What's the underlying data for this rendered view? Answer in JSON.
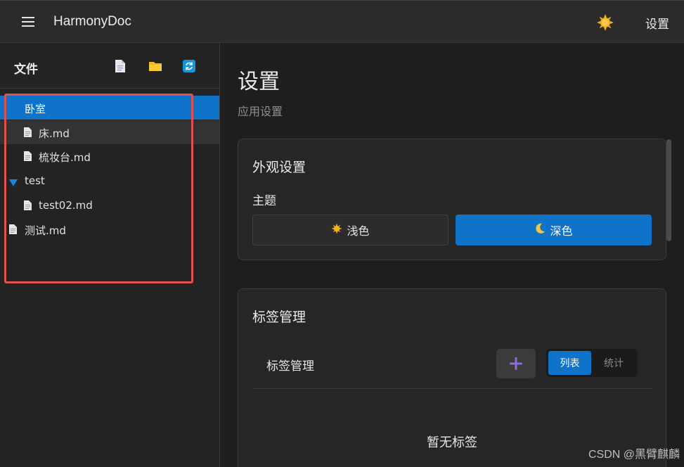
{
  "app": {
    "title": "HarmonyDoc",
    "settings_label": "设置"
  },
  "sidebar": {
    "title": "文件",
    "items": [
      {
        "label": "卧室",
        "kind": "folder-open",
        "state": "selected"
      },
      {
        "label": "床.md",
        "kind": "file",
        "state": "hover"
      },
      {
        "label": "梳妆台.md",
        "kind": "file",
        "state": ""
      },
      {
        "label": "test",
        "kind": "folder-expanded",
        "state": ""
      },
      {
        "label": "test02.md",
        "kind": "file",
        "state": ""
      },
      {
        "label": "测试.md",
        "kind": "file",
        "state": ""
      }
    ]
  },
  "main": {
    "title": "设置",
    "subtitle": "应用设置",
    "appearance": {
      "title": "外观设置",
      "theme_label": "主题",
      "light_label": "浅色",
      "dark_label": "深色",
      "selected": "dark"
    },
    "tags": {
      "title": "标签管理",
      "row_label": "标签管理",
      "tab_list": "列表",
      "tab_stats": "统计",
      "empty": "暂无标签"
    }
  },
  "watermark": "CSDN @黑臂麒麟",
  "colors": {
    "accent": "#0f73c9",
    "highlight_border": "#e0504f",
    "plus": "#8b6fd6"
  }
}
